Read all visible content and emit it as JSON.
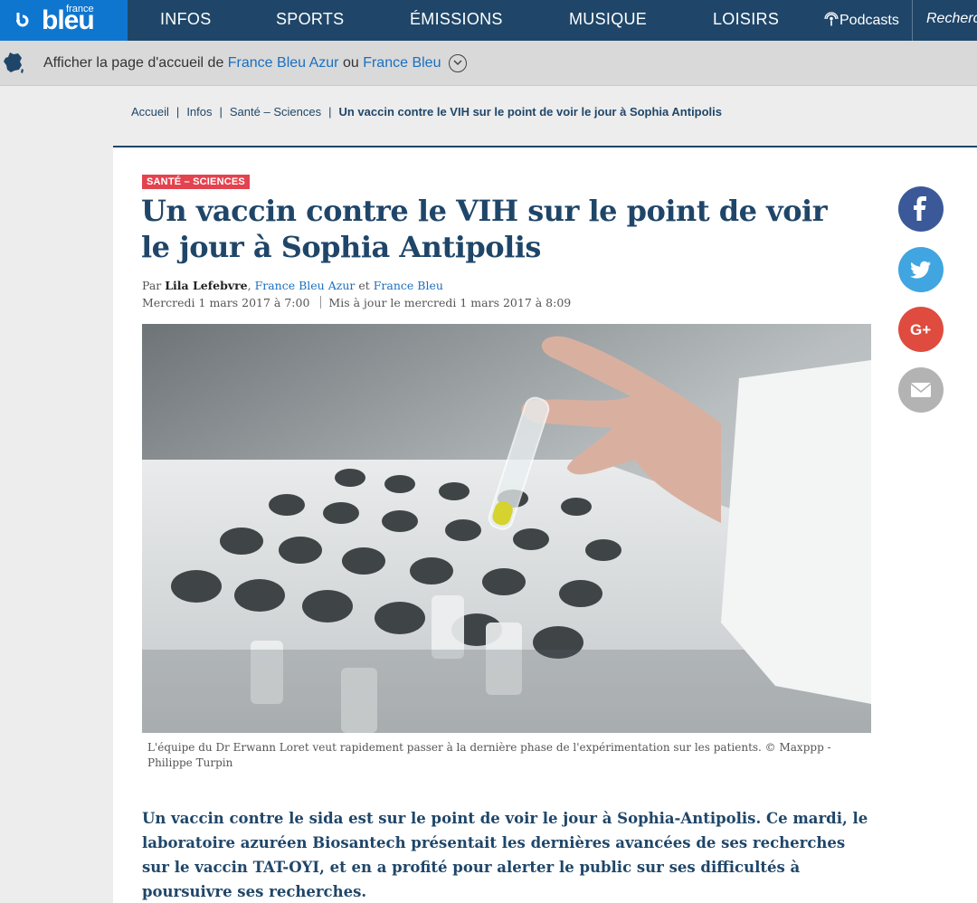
{
  "brand": {
    "line1": "france",
    "line2": "bleu"
  },
  "nav": {
    "items": [
      "INFOS",
      "SPORTS",
      "ÉMISSIONS",
      "MUSIQUE",
      "LOISIRS"
    ],
    "podcasts": "Podcasts",
    "search": "Recherche"
  },
  "station": {
    "prefix": "Afficher la page d'accueil de ",
    "link1": "France Bleu Azur",
    "mid": " ou ",
    "link2": "France Bleu"
  },
  "breadcrumb": {
    "items": [
      "Accueil",
      "Infos",
      "Santé – Sciences"
    ],
    "current": "Un vaccin contre le VIH sur le point de voir le jour à Sophia Antipolis"
  },
  "article": {
    "tag": "SANTÉ – SCIENCES",
    "title": "Un vaccin contre le VIH sur le point de voir le jour à Sophia Antipolis",
    "by_prefix": "Par ",
    "author": "Lila Lefebvre",
    "station1": "France Bleu Azur",
    "and": " et ",
    "station2": "France Bleu",
    "published": "Mercredi 1 mars 2017 à 7:00",
    "updated": "Mis à jour le mercredi 1 mars 2017 à 8:09",
    "caption": "L'équipe du Dr Erwann Loret veut rapidement passer à la dernière phase de l'expérimentation sur les patients. © Maxppp - Philippe Turpin",
    "lead": "Un vaccin contre le sida est sur le point de voir le jour à Sophia-Antipolis. Ce mardi, le laboratoire azuréen Biosantech présentait les dernières avancées de ses recherches sur le vaccin TAT-OYI, et en a profité pour alerter le public sur ses difficultés à poursuivre ses recherches."
  },
  "social": [
    {
      "icon": "facebook-icon",
      "color": "#3b5998"
    },
    {
      "icon": "twitter-icon",
      "color": "#40a5e0"
    },
    {
      "icon": "google-plus-icon",
      "color": "#df4b3e"
    },
    {
      "icon": "email-icon",
      "color": "#b3b3b3"
    }
  ],
  "colors": {
    "navy": "#1f4669",
    "logo_blue": "#0f76d0",
    "tag_red": "#e3434f",
    "link_blue": "#1a6fc0"
  }
}
